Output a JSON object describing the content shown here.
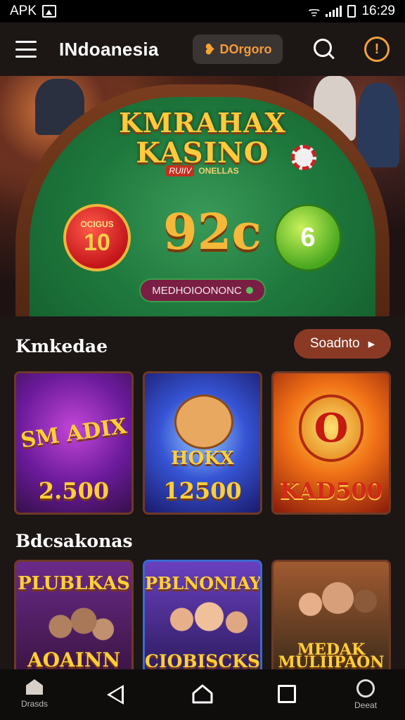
{
  "status_bar": {
    "carrier": "APK",
    "time": "16:29"
  },
  "header": {
    "title": "INdoanesia",
    "promo_label": "DOrgoro",
    "promo_icon": "v-icon"
  },
  "hero": {
    "title_line1": "KMRAHAX",
    "title_line2": "KASINO",
    "subtitle_badge": "RUIIV",
    "subtitle_text": "ONELLAS",
    "coin_left_small": "OCIGUS",
    "coin_left_value": "10",
    "big_value": "92c",
    "coin_right_value": "6",
    "pill_label": "MEDHOIOONONC"
  },
  "section1": {
    "title": "Kmkedae",
    "see_all": "Soadnto",
    "cards": [
      {
        "name": "SM ADIX",
        "amount": "2.500"
      },
      {
        "name": "HOKX",
        "amount": "12500"
      },
      {
        "name": "O",
        "amount": "KAD500"
      }
    ]
  },
  "section2": {
    "title": "Bdcsakonas",
    "cards": [
      {
        "top": "PLUBLKAS",
        "bottom": "AOAINN"
      },
      {
        "top": "PBLNONIAY",
        "bottom": "CIOBISCKS"
      },
      {
        "top": "MEDAK",
        "bottom": "MULIIPAON"
      }
    ]
  },
  "bottom_nav": {
    "home_label": "Drasds",
    "account_label": "Deeat"
  }
}
